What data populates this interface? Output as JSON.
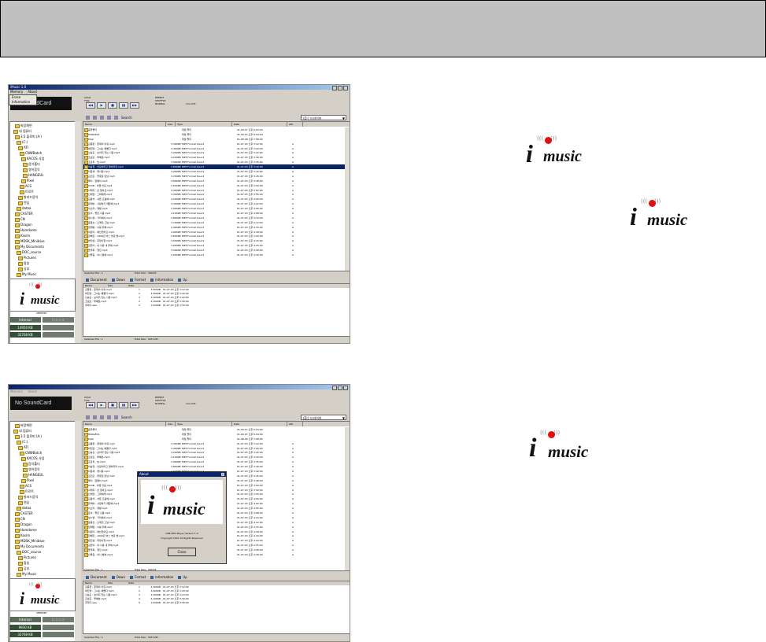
{
  "shot1": {
    "title": "iMusic 1.0",
    "menu": [
      "Memory",
      "About"
    ],
    "submenu": [
      "Erase",
      "Information"
    ],
    "sound_card": "No SoundCard",
    "meta": [
      "Artist",
      "Title",
      "Genre"
    ],
    "mode": [
      "REPEAT",
      "SHUFFLE",
      "NORMAL"
    ],
    "volume": "VOLUME",
    "search": "Search",
    "drive": "(D:) 드라이브",
    "tree": [
      "바탕화면",
      "내 컴퓨터",
      "3.5 플로피 (A:)",
      "(C:)",
      "ATI",
      "CNWBatch",
      "KACOS 사업",
      "음악폴더",
      "영어음악",
      "HANGEUL",
      "Pixel",
      "ACS",
      "트로트",
      "발라드음악",
      "연습",
      "dataa",
      "CASTER",
      "CN",
      "Dragon",
      "Hamdame",
      "Kasim",
      "MDSK_Miniblue",
      "My Documents",
      "DOC_source",
      "Pictures",
      "팝송",
      "공부",
      "My Music"
    ],
    "columns": [
      "Name",
      "Size",
      "Type",
      "Date",
      "Attr"
    ],
    "files": [
      {
        "name": "음악폴더",
        "size": "",
        "type": "파일 폴더",
        "date": "01-09-07 오후 6:03:00",
        "attr": ""
      },
      {
        "name": "HANGEUL",
        "size": "",
        "type": "파일 폴더",
        "date": "01-09-07 오후 6:04:00",
        "attr": ""
      },
      {
        "name": "Pixel",
        "size": "",
        "type": "파일 폴더",
        "date": "01-08-08 오후 7:08:00",
        "attr": ""
      },
      {
        "name": "김종환 - 존재의 이유.mp3",
        "size": "3,300KB",
        "type": "MP3 Format Sound",
        "date": "01-07-03 오후 3:12:00",
        "attr": "A"
      },
      {
        "name": "박진영 - 그녀는 예뻤다.mp3",
        "size": "3,400KB",
        "type": "MP3 Format Sound",
        "date": "01-07-03 오후 3:20:00",
        "attr": "A"
      },
      {
        "name": "신승훈 - 보이지 않는 사랑.mp3",
        "size": "3,200KB",
        "type": "MP3 Format Sound",
        "date": "01-07-03 오후 3:22:00",
        "attr": "A"
      },
      {
        "name": "조성모 - 투헤븐.mp3",
        "size": "4,100KB",
        "type": "MP3 Format Sound",
        "date": "01-07-03 오후 3:30:00",
        "attr": "A"
      },
      {
        "name": "조관우 - 늪.mp3",
        "size": "3,900KB",
        "type": "MP3 Format Sound",
        "date": "01-07-03 오후 3:35:00",
        "attr": "A"
      },
      {
        "name": "이승철 - 안녕이라고 말하지마.mp3",
        "size": "3,800KB",
        "type": "MP3 Format Sound",
        "date": "01-07-03 오후 3:40:00",
        "attr": "A"
      },
      {
        "name": "이문세 - 옛사랑.mp3",
        "size": "4,000KB",
        "type": "MP3 Format Sound",
        "date": "01-07-03 오후 3:42:00",
        "attr": "A"
      },
      {
        "name": "김건모 - 잘못된 만남.mp3",
        "size": "3,700KB",
        "type": "MP3 Format Sound",
        "date": "01-07-03 오후 3:45:00",
        "attr": "A"
      },
      {
        "name": "패닉 - 달팽이.mp3",
        "size": "3,600KB",
        "type": "MP3 Format Sound",
        "date": "01-07-03 오후 3:48:00",
        "attr": "A"
      },
      {
        "name": "015B - 이젠 안녕.mp3",
        "size": "3,500KB",
        "type": "MP3 Format Sound",
        "date": "01-07-03 오후 3:50:00",
        "attr": "A"
      },
      {
        "name": "서태지 - 난 알아요.mp3",
        "size": "3,400KB",
        "type": "MP3 Format Sound",
        "date": "01-07-03 오후 3:52:00",
        "attr": "A"
      },
      {
        "name": "신해철 - 그대에게.mp3",
        "size": "3,300KB",
        "type": "MP3 Format Sound",
        "date": "01-07-03 오후 3:55:00",
        "attr": "A"
      },
      {
        "name": "김광석 - 서른 즈음에.mp3",
        "size": "4,200KB",
        "type": "MP3 Format Sound",
        "date": "01-07-03 오후 4:00:00",
        "attr": "A"
      },
      {
        "name": "유재하 - 사랑하기 때문에.mp3",
        "size": "4,300KB",
        "type": "MP3 Format Sound",
        "date": "01-07-03 오후 4:02:00",
        "attr": "A"
      },
      {
        "name": "이소라 - 제발.mp3",
        "size": "3,900KB",
        "type": "MP3 Format Sound",
        "date": "01-07-03 오후 4:05:00",
        "attr": "A"
      },
      {
        "name": "토이 - 좋은 사람.mp3",
        "size": "4,100KB",
        "type": "MP3 Format Sound",
        "date": "01-07-03 오후 4:08:00",
        "attr": "A"
      },
      {
        "name": "성시경 - 거리에서.mp3",
        "size": "3,800KB",
        "type": "MP3 Format Sound",
        "date": "01-07-03 오후 4:10:00",
        "attr": "A"
      },
      {
        "name": "윤종신 - 오래전 그날.mp3",
        "size": "3,700KB",
        "type": "MP3 Format Sound",
        "date": "01-07-03 오후 4:12:00",
        "attr": "A"
      },
      {
        "name": "임재범 - 너를 위해.mp3",
        "size": "4,400KB",
        "type": "MP3 Format Sound",
        "date": "01-07-03 오후 4:15:00",
        "attr": "A"
      },
      {
        "name": "이은미 - 애인있어요.mp3",
        "size": "4,000KB",
        "type": "MP3 Format Sound",
        "date": "01-07-03 오후 4:18:00",
        "attr": "A"
      },
      {
        "name": "장혜진 - 1994년 어느 늦은 밤.mp3",
        "size": "3,600KB",
        "type": "MP3 Format Sound",
        "date": "01-07-03 오후 4:20:00",
        "attr": "A"
      },
      {
        "name": "변진섭 - 희망사항.mp3",
        "size": "3,500KB",
        "type": "MP3 Format Sound",
        "date": "01-07-03 오후 4:22:00",
        "attr": "A"
      },
      {
        "name": "김현식 - 내 사랑 내 곁에.mp3",
        "size": "3,900KB",
        "type": "MP3 Format Sound",
        "date": "01-07-03 오후 4:25:00",
        "attr": "A"
      },
      {
        "name": "들국화 - 행진.mp3",
        "size": "3,300KB",
        "type": "MP3 Format Sound",
        "date": "01-07-03 오후 4:28:00",
        "attr": "A"
      },
      {
        "name": "산울림 - 아니 벌써.mp3",
        "size": "3,200KB",
        "type": "MP3 Format Sound",
        "date": "01-07-03 오후 4:30:00",
        "attr": "A"
      }
    ],
    "status_selected": "Selected File : 1",
    "status_total": "Total Size : 3900 B",
    "tabs": [
      "Document",
      "Down",
      "Format",
      "Information",
      "Up"
    ],
    "mem_columns": [
      "Name",
      "Size",
      "Date"
    ],
    "mem_files": [
      {
        "name": "김종환 - 존재의 이유.mp3",
        "size": "1",
        "bytes": "3,300KB",
        "date": "01-07-03 오후 3:12:00"
      },
      {
        "name": "박진영 - 그녀는 예뻤다.mp3",
        "size": "2",
        "bytes": "3,400KB",
        "date": "01-07-03 오후 3:20:00"
      },
      {
        "name": "신승훈 - 보이지 않는 사랑.mp3",
        "size": "3",
        "bytes": "3,200KB",
        "date": "01-07-03 오후 3:22:00"
      },
      {
        "name": "조성모 - 투헤븐.mp3",
        "size": "4",
        "bytes": "4,100KB",
        "date": "01-07-03 오후 3:30:00"
      },
      {
        "name": "주제가.wav",
        "size": "5",
        "bytes": "1,500KB",
        "date": "01-07-03 오후 3:35:00"
      }
    ],
    "memory_label": "MEMORY",
    "internal": "Internal",
    "external": "External",
    "mem_free": "14950 KB",
    "mem_total": "32768 KB",
    "mem_status_selected": "Selected File : 1",
    "mem_status_total": "Total Size : 3931 KB"
  },
  "shot2": {
    "sound_card": "No SoundCard",
    "about_title": "About",
    "about_version": "USB MP3 Player Version 1.0",
    "about_copyright": "Copyright 2001 All Rights Reserved",
    "about_ok": "Close",
    "mem_free": "9930 KB",
    "mem_total": "32768 KB"
  },
  "logo": {
    "i": "i",
    "word": "music"
  },
  "colors": {
    "topbar": "#c0c0c0",
    "titlebar": "#0a246a",
    "logo_dot": "#e01010",
    "memory_bar": "#5a6b5a"
  }
}
